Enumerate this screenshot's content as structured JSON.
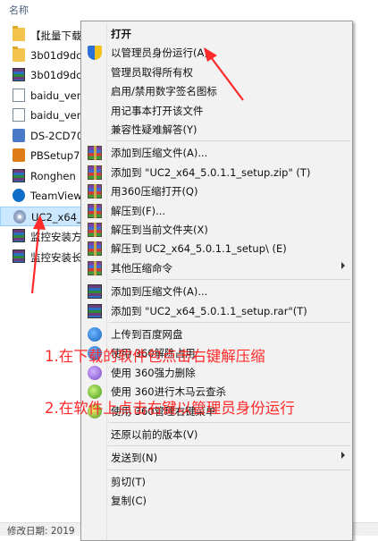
{
  "explorer": {
    "column_name": "名称",
    "files": [
      {
        "name": "【批量下载",
        "icon": "folder-icon"
      },
      {
        "name": "3b01d9dc",
        "icon": "folder-icon"
      },
      {
        "name": "3b01d9dc",
        "icon": "winrar-icon"
      },
      {
        "name": "baidu_ver",
        "icon": "document-icon"
      },
      {
        "name": "baidu_ver",
        "icon": "document-icon"
      },
      {
        "name": "DS-2CD70",
        "icon": "computer-icon"
      },
      {
        "name": "PBSetup7",
        "icon": "installer-icon"
      },
      {
        "name": "Ronghen",
        "icon": "winrar-icon"
      },
      {
        "name": "TeamView",
        "icon": "teamviewer-icon"
      },
      {
        "name": "UC2_x64_",
        "icon": "disc-icon"
      },
      {
        "name": "监控安装方",
        "icon": "winrar-icon"
      },
      {
        "name": "监控安装长",
        "icon": "winrar-icon"
      }
    ],
    "status_text": "修改日期: 2019"
  },
  "context_menu": {
    "items": [
      {
        "label": "打开",
        "icon": "",
        "bold": true,
        "arrow": false
      },
      {
        "label": "以管理员身份运行(A)",
        "icon": "uac-shield-icon",
        "bold": false,
        "arrow": false
      },
      {
        "label": "管理员取得所有权",
        "icon": "",
        "bold": false,
        "arrow": false
      },
      {
        "label": "启用/禁用数字签名图标",
        "icon": "",
        "bold": false,
        "arrow": false
      },
      {
        "label": "用记事本打开该文件",
        "icon": "",
        "bold": false,
        "arrow": false
      },
      {
        "label": "兼容性疑难解答(Y)",
        "icon": "",
        "bold": false,
        "arrow": false
      },
      {
        "sep": true
      },
      {
        "label": "添加到压缩文件(A)...",
        "icon": "360zip-icon",
        "bold": false,
        "arrow": false
      },
      {
        "label": "添加到 \"UC2_x64_5.0.1.1_setup.zip\" (T)",
        "icon": "360zip-icon",
        "bold": false,
        "arrow": false
      },
      {
        "label": "用360压缩打开(Q)",
        "icon": "360zip-icon",
        "bold": false,
        "arrow": false
      },
      {
        "label": "解压到(F)...",
        "icon": "360zip-icon",
        "bold": false,
        "arrow": false
      },
      {
        "label": "解压到当前文件夹(X)",
        "icon": "360zip-icon",
        "bold": false,
        "arrow": false
      },
      {
        "label": "解压到 UC2_x64_5.0.1.1_setup\\ (E)",
        "icon": "360zip-icon",
        "bold": false,
        "arrow": false
      },
      {
        "label": "其他压缩命令",
        "icon": "360zip-icon",
        "bold": false,
        "arrow": true
      },
      {
        "sep": true
      },
      {
        "label": "添加到压缩文件(A)...",
        "icon": "winrar-icon",
        "bold": false,
        "arrow": false
      },
      {
        "label": "添加到 \"UC2_x64_5.0.1.1_setup.rar\"(T)",
        "icon": "winrar-icon",
        "bold": false,
        "arrow": false
      },
      {
        "sep": true
      },
      {
        "label": "上传到百度网盘",
        "icon": "baidu-netdisk-icon",
        "bold": false,
        "arrow": false
      },
      {
        "label": "使用 360解除占用",
        "icon": "360-unlock-icon",
        "bold": false,
        "arrow": false
      },
      {
        "label": "使用 360强力删除",
        "icon": "360-delete-icon",
        "bold": false,
        "arrow": false
      },
      {
        "label": "使用 360进行木马云查杀",
        "icon": "360-scan-icon",
        "bold": false,
        "arrow": false
      },
      {
        "label": "使用 360管理右键菜单",
        "icon": "360-menu-icon",
        "bold": false,
        "arrow": false
      },
      {
        "sep": true
      },
      {
        "label": "还原以前的版本(V)",
        "icon": "",
        "bold": false,
        "arrow": false
      },
      {
        "sep": true
      },
      {
        "label": "发送到(N)",
        "icon": "",
        "bold": false,
        "arrow": true
      },
      {
        "sep": true
      },
      {
        "label": "剪切(T)",
        "icon": "",
        "bold": false,
        "arrow": false
      },
      {
        "label": "复制(C)",
        "icon": "",
        "bold": false,
        "arrow": false
      }
    ]
  },
  "annotations": {
    "step1": "1.在下载的软件包点击右键解压缩",
    "step2": "2.在软件上点击右键以管理员身份运行",
    "color": "#ff2a2a"
  }
}
